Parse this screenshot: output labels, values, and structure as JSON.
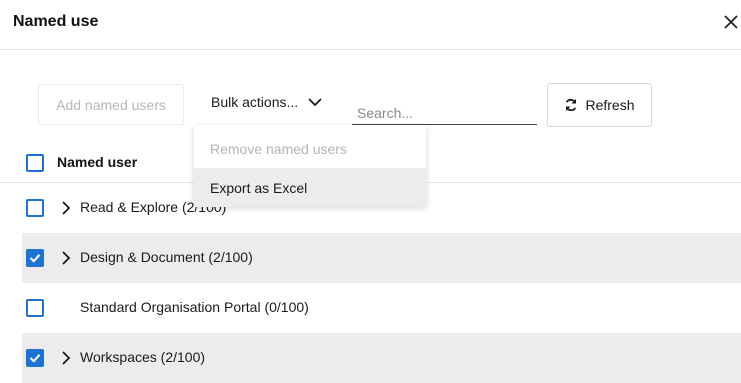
{
  "dialog": {
    "title": "Named use"
  },
  "toolbar": {
    "add_label": "Add named users",
    "bulk_label": "Bulk actions...",
    "search_placeholder": "Search...",
    "refresh_label": "Refresh"
  },
  "bulk_menu": {
    "items": [
      {
        "label": "Remove named users",
        "enabled": false
      },
      {
        "label": "Export as Excel",
        "enabled": true
      }
    ]
  },
  "table": {
    "header": "Named user",
    "header_checked": false,
    "rows": [
      {
        "label": "Read & Explore (2/100)",
        "checked": false,
        "expandable": true,
        "shaded": false
      },
      {
        "label": "Design & Document (2/100)",
        "checked": true,
        "expandable": true,
        "shaded": true
      },
      {
        "label": "Standard Organisation Portal (0/100)",
        "checked": false,
        "expandable": false,
        "shaded": false
      },
      {
        "label": "Workspaces (2/100)",
        "checked": true,
        "expandable": true,
        "shaded": true
      }
    ]
  },
  "colors": {
    "accent": "#1f73d0",
    "row_shade": "#ececec"
  }
}
